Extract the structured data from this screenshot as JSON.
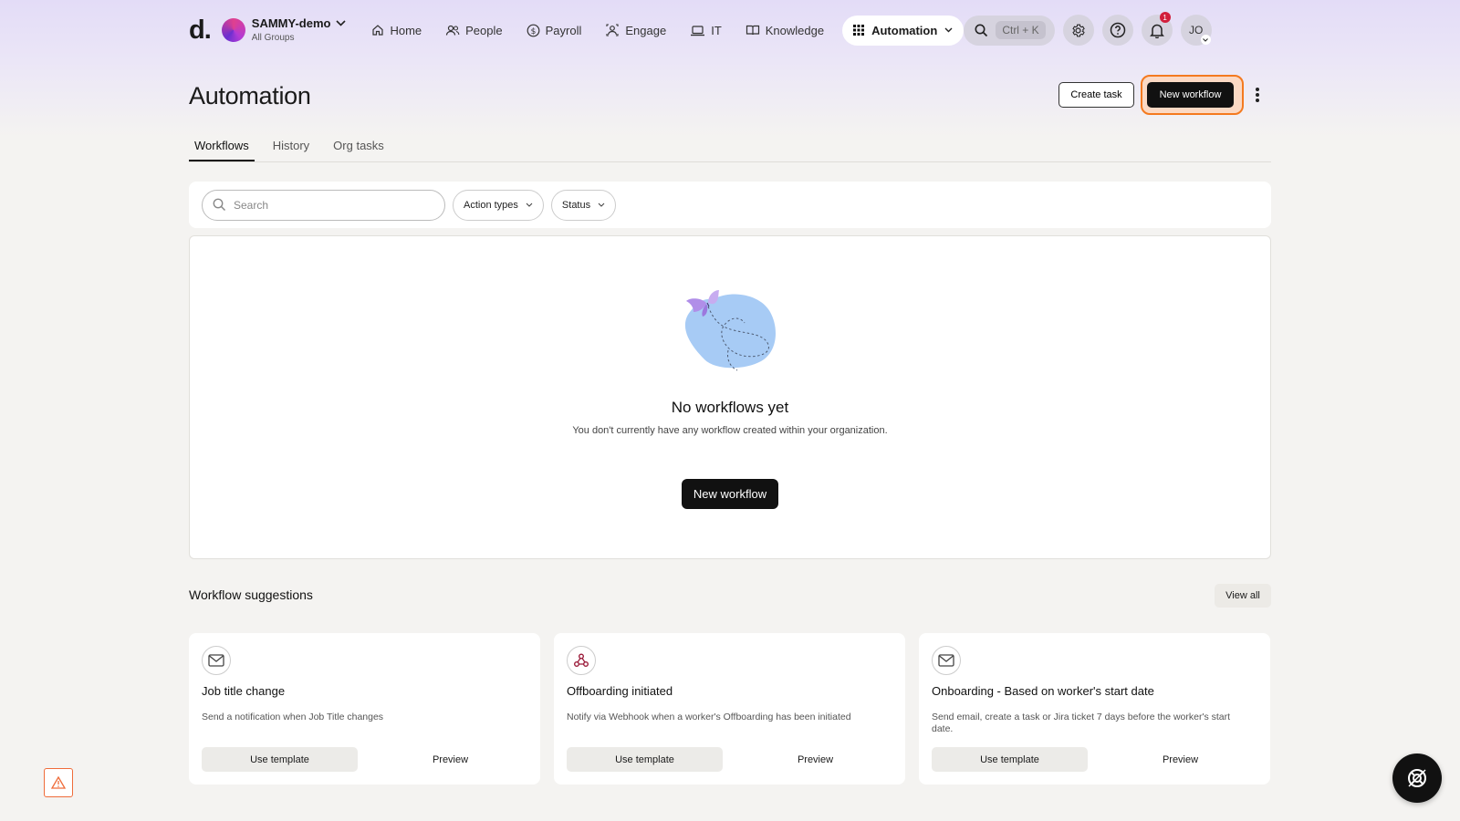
{
  "header": {
    "logo": "d.",
    "org": {
      "name": "SAMMY-demo",
      "subtitle": "All Groups"
    },
    "nav": [
      {
        "label": "Home",
        "icon": "home-icon"
      },
      {
        "label": "People",
        "icon": "people-icon"
      },
      {
        "label": "Payroll",
        "icon": "dollar-icon"
      },
      {
        "label": "Engage",
        "icon": "engage-icon"
      },
      {
        "label": "IT",
        "icon": "laptop-icon"
      },
      {
        "label": "Knowledge",
        "icon": "book-icon"
      }
    ],
    "active_app": "Automation",
    "search_shortcut": "Ctrl + K",
    "notifications_count": "1",
    "user_initials": "JO"
  },
  "page": {
    "title": "Automation",
    "create_task_label": "Create task",
    "new_workflow_label": "New workflow"
  },
  "tabs": [
    {
      "label": "Workflows",
      "active": true
    },
    {
      "label": "History",
      "active": false
    },
    {
      "label": "Org tasks",
      "active": false
    }
  ],
  "filters": {
    "search_placeholder": "Search",
    "action_types_label": "Action types",
    "status_label": "Status"
  },
  "empty_state": {
    "title": "No workflows yet",
    "subtitle": "You don't currently have any workflow created within your organization.",
    "button_label": "New workflow"
  },
  "suggestions": {
    "title": "Workflow suggestions",
    "view_all_label": "View all",
    "cards": [
      {
        "title": "Job title change",
        "description": "Send a notification when Job Title changes",
        "icon": "mail-icon",
        "use_label": "Use template",
        "preview_label": "Preview"
      },
      {
        "title": "Offboarding initiated",
        "description": "Notify via Webhook when a worker's Offboarding has been initiated",
        "icon": "webhook-icon",
        "use_label": "Use template",
        "preview_label": "Preview"
      },
      {
        "title": "Onboarding - Based on worker's start date",
        "description": "Send email, create a task or Jira ticket 7 days before the worker's start date.",
        "icon": "mail-icon",
        "use_label": "Use template",
        "preview_label": "Preview"
      }
    ]
  },
  "colors": {
    "accent_ring": "#f47a1f",
    "primary_button": "#111111",
    "illustration_blob": "#a7cbf5",
    "butterfly": "#b08ee8"
  }
}
